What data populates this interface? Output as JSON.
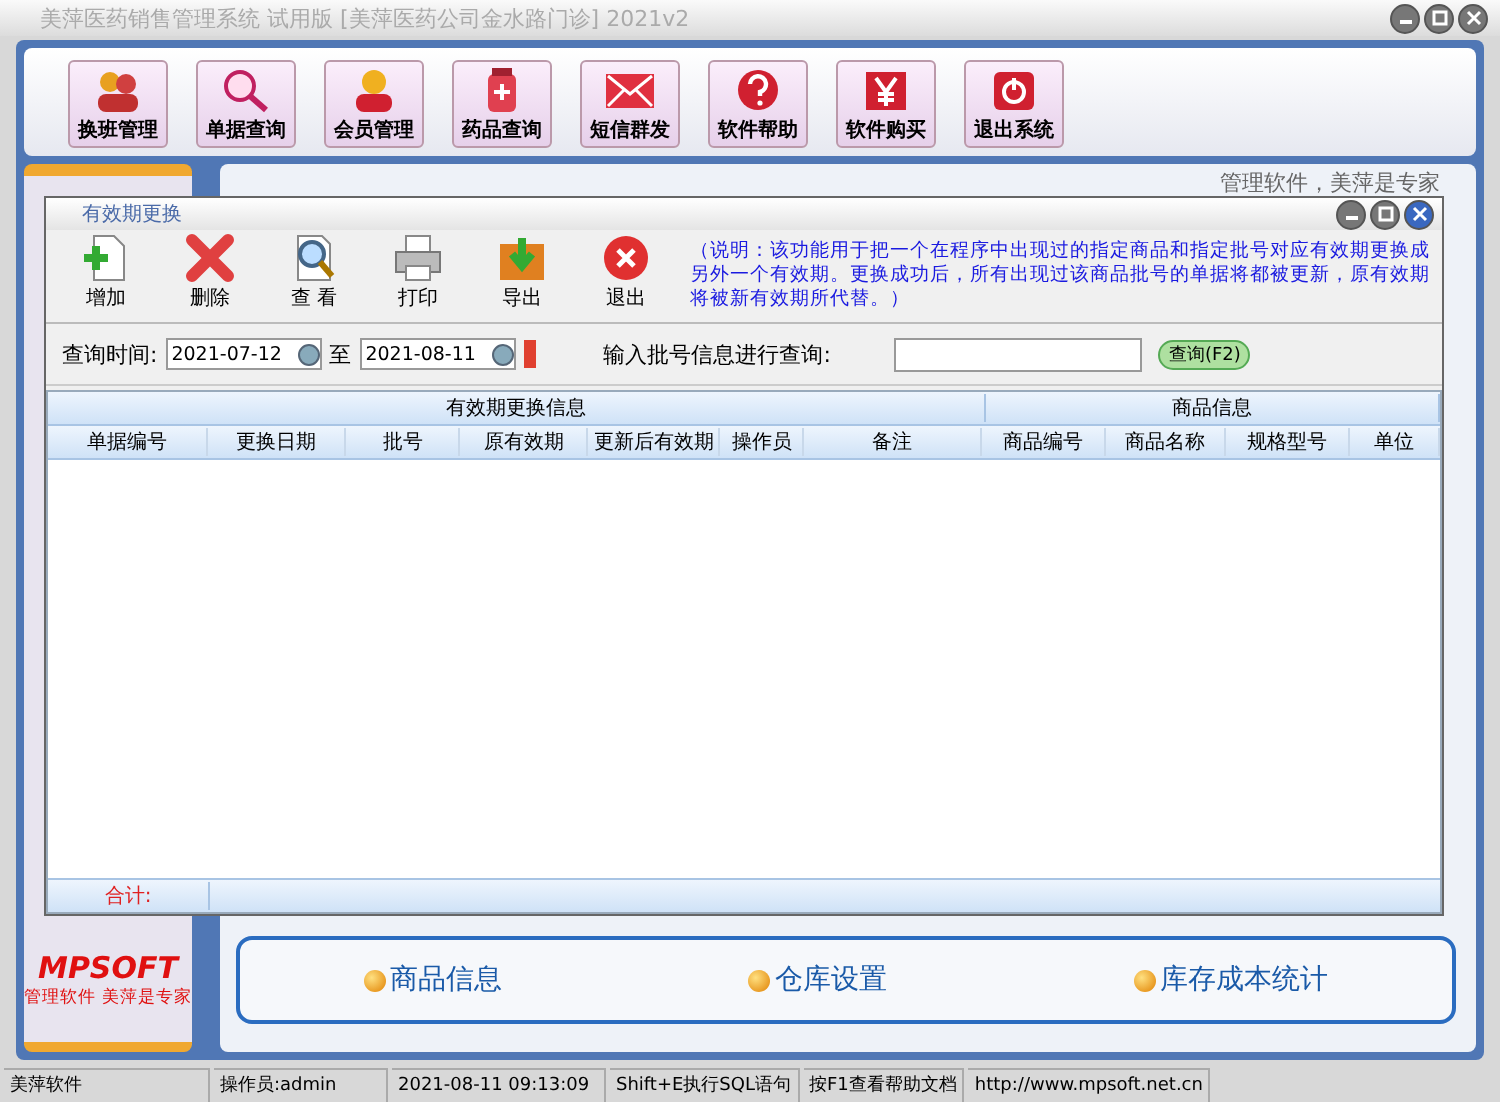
{
  "window": {
    "title": "美萍医药销售管理系统 试用版 [美萍医药公司金水路门诊] 2021v2"
  },
  "toolbar": [
    {
      "label": "换班管理",
      "kind": "people"
    },
    {
      "label": "单据查询",
      "kind": "search"
    },
    {
      "label": "会员管理",
      "kind": "person"
    },
    {
      "label": "药品查询",
      "kind": "medicine"
    },
    {
      "label": "短信群发",
      "kind": "mail"
    },
    {
      "label": "软件帮助",
      "kind": "help"
    },
    {
      "label": "软件购买",
      "kind": "yen"
    },
    {
      "label": "退出系统",
      "kind": "power"
    }
  ],
  "slogan": "管理软件，美萍是专家",
  "sidebar": {
    "logo": "MPSOFT",
    "tagline": "管理软件  美萍是专家"
  },
  "dialog": {
    "title": "有效期更换",
    "toolbar": [
      {
        "label": "增加",
        "kind": "add"
      },
      {
        "label": "删除",
        "kind": "delete"
      },
      {
        "label": "查  看",
        "kind": "view"
      },
      {
        "label": "打印",
        "kind": "print"
      },
      {
        "label": "导出",
        "kind": "export"
      },
      {
        "label": "退出",
        "kind": "exit"
      }
    ],
    "note": "（说明：该功能用于把一个在程序中出现过的指定商品和指定批号对应有效期更换成另外一个有效期。更换成功后，所有出现过该商品批号的单据将都被更新，原有效期将被新有效期所代替。）",
    "filter": {
      "label": "查询时间:",
      "from": "2021-07-12",
      "to_label": "至",
      "to": "2021-08-11",
      "batch_label": "输入批号信息进行查询:",
      "search_button": "查询(F2)"
    },
    "table": {
      "groups": [
        {
          "label": "有效期更换信息"
        },
        {
          "label": "商品信息"
        }
      ],
      "columns": [
        "单据编号",
        "更换日期",
        "批号",
        "原有效期",
        "更新后有效期",
        "操作员",
        "备注",
        "商品编号",
        "商品名称",
        "规格型号",
        "单位"
      ],
      "footer": "合计:"
    }
  },
  "links": [
    "商品信息",
    "仓库设置",
    "库存成本统计"
  ],
  "status_bar": [
    "美萍软件",
    "操作员:admin",
    "2021-08-11 09:13:09",
    "Shift+E执行SQL语句",
    "按F1查看帮助文档",
    "http://www.mpsoft.net.cn"
  ]
}
